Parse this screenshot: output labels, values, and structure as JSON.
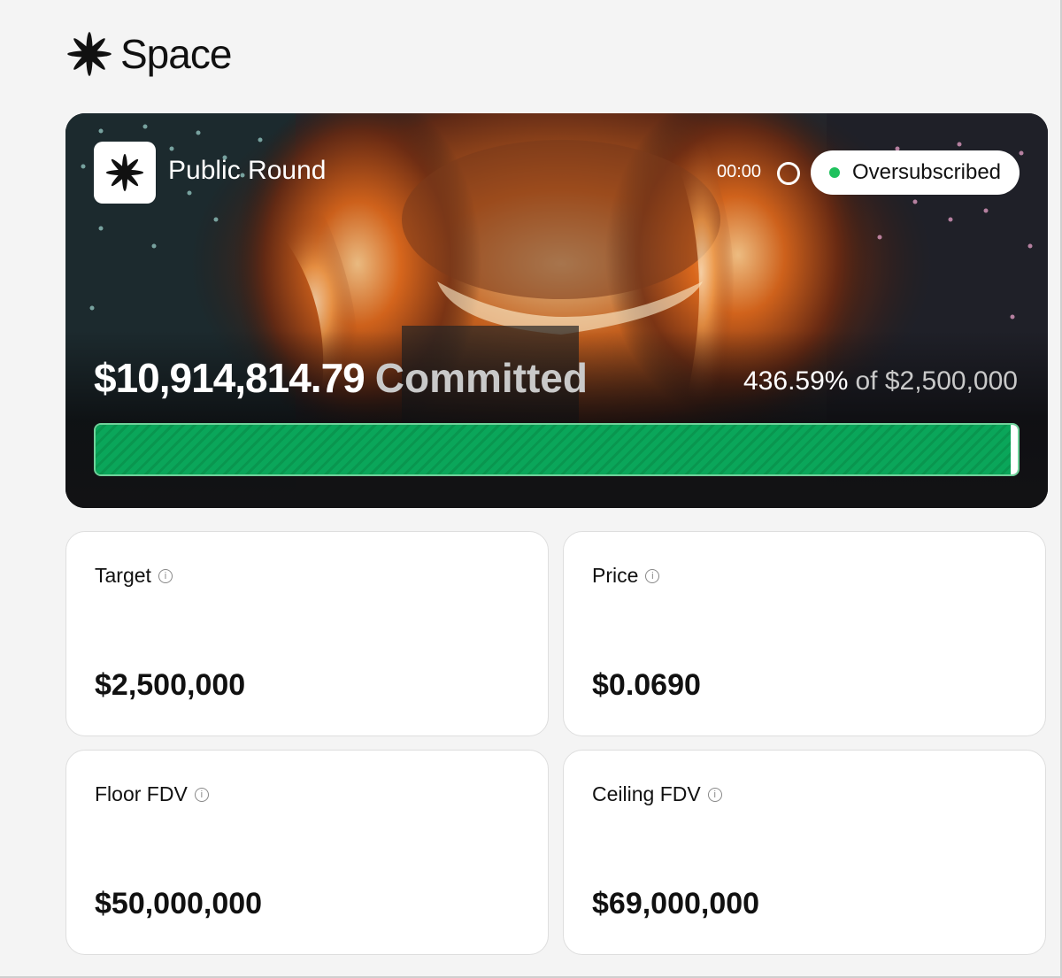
{
  "brand": {
    "name": "Space",
    "logo_icon": "asterisk-icon"
  },
  "round": {
    "title": "Public Round",
    "timer": "00:00",
    "status": "Oversubscribed",
    "status_color": "#1fc15d",
    "committed_amount": "$10,914,814.79",
    "committed_label": "Committed",
    "percent": "436.59%",
    "of_target": "of $2,500,000",
    "progress_fraction": 1.0
  },
  "stats": [
    {
      "label": "Target",
      "value": "$2,500,000"
    },
    {
      "label": "Price",
      "value": "$0.0690"
    },
    {
      "label": "Floor FDV",
      "value": "$50,000,000"
    },
    {
      "label": "Ceiling FDV",
      "value": "$69,000,000"
    }
  ],
  "colors": {
    "accent_green": "#0aa65a",
    "background": "#f4f4f4"
  }
}
